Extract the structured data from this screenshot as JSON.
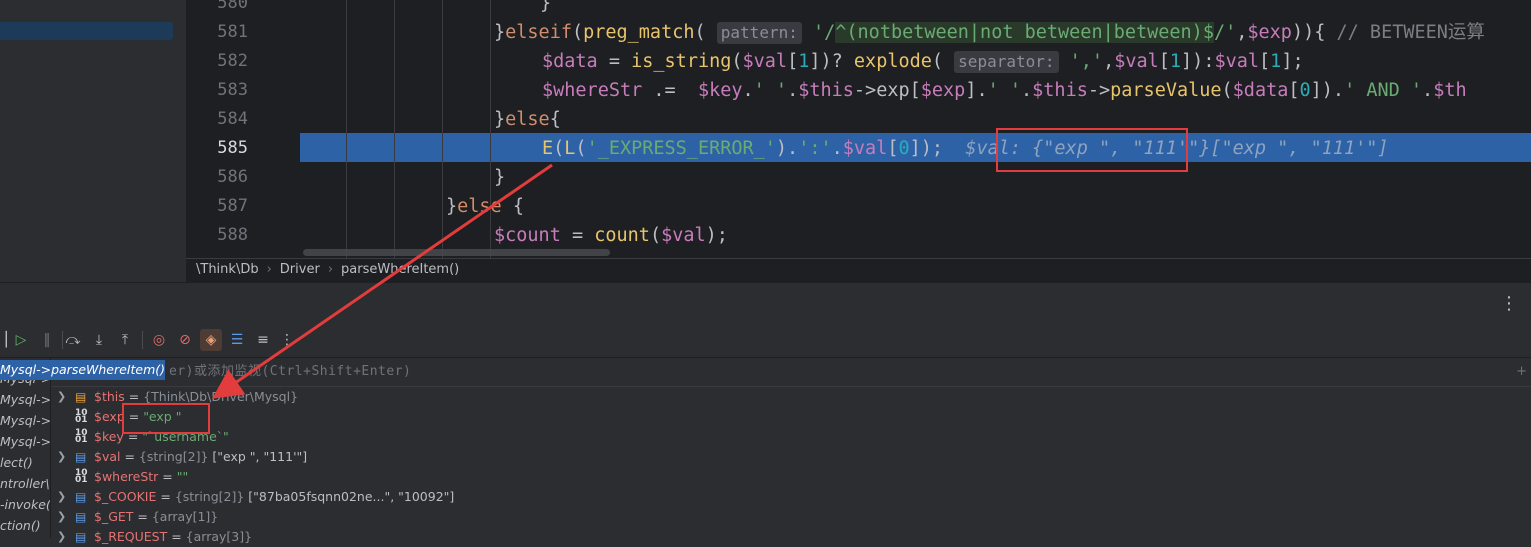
{
  "editor": {
    "lines": [
      {
        "num": "580"
      },
      {
        "num": "581"
      },
      {
        "num": "582"
      },
      {
        "num": "583"
      },
      {
        "num": "584"
      },
      {
        "num": "585"
      },
      {
        "num": "586"
      },
      {
        "num": "587"
      },
      {
        "num": "588"
      }
    ],
    "hints": {
      "pattern": "pattern:",
      "separator": "separator:"
    },
    "comment_581": "// BETWEEN运算",
    "inline_value_585": "$val: {\"exp \", \"111'\"}[\"exp \", \"111'\"]"
  },
  "breadcrumb": {
    "items": [
      "\\Think\\Db",
      "Driver",
      "parseWhereItem()"
    ]
  },
  "debug": {
    "more_label": "⋮",
    "watch_placeholder": "er)或添加监视(Ctrl+Shift+Enter)",
    "frames": [
      "Mysql->parseWhereItem()",
      "Mysql->p",
      "Mysql->p",
      "Mysql->b",
      "Mysql->s",
      "lect()",
      "ntroller\\",
      "-invoke(",
      "ction()"
    ],
    "variables": [
      {
        "name": "$this",
        "eq": " = ",
        "type": "{Think\\Db\\Driver\\Mysql}",
        "value": "",
        "expandable": true,
        "icon": "object-icon"
      },
      {
        "name": "$exp",
        "eq": " = ",
        "type": "",
        "value": "\"exp \"",
        "expandable": false,
        "icon": "primitive-icon"
      },
      {
        "name": "$key",
        "eq": " = ",
        "type": "",
        "value": "\"`username`\"",
        "expandable": false,
        "icon": "primitive-icon"
      },
      {
        "name": "$val",
        "eq": " = ",
        "type": "{string[2]}",
        "value": " [\"exp \", \"111'\"]",
        "expandable": true,
        "icon": "array-icon"
      },
      {
        "name": "$whereStr",
        "eq": " = ",
        "type": "",
        "value": "\"\"",
        "expandable": false,
        "icon": "primitive-icon"
      },
      {
        "name": "$_COOKIE",
        "eq": " = ",
        "type": "{string[2]}",
        "value": " [\"87ba05fsqnn02ne...\", \"10092\"]",
        "expandable": true,
        "icon": "array-icon"
      },
      {
        "name": "$_GET",
        "eq": " = ",
        "type": "{array[1]}",
        "value": "",
        "expandable": true,
        "icon": "array-icon"
      },
      {
        "name": "$_REQUEST",
        "eq": " = ",
        "type": "{array[3]}",
        "value": "",
        "expandable": true,
        "icon": "array-icon"
      }
    ]
  },
  "colors": {
    "annotation_red": "#e23c3c",
    "current_line": "#2e62a6"
  }
}
